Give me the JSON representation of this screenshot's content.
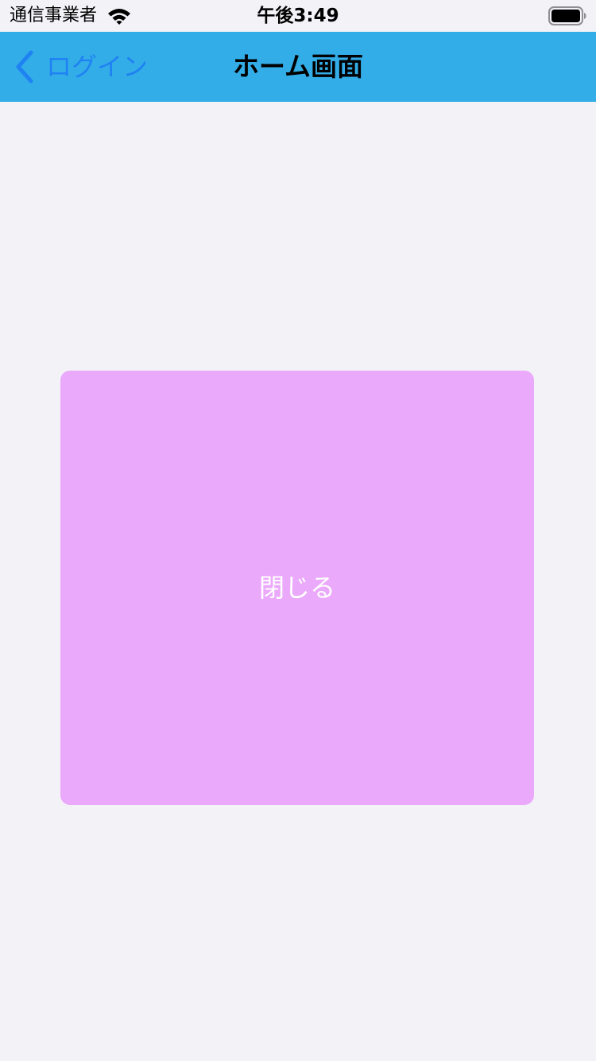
{
  "status_bar": {
    "carrier": "通信事業者",
    "time": "午後3:49",
    "wifi_icon": "wifi-icon",
    "battery_icon": "battery-full-icon"
  },
  "nav_bar": {
    "back_label": "ログイン",
    "back_icon": "chevron-left-icon",
    "title": "ホーム画面",
    "background_color": "#33ade7",
    "back_color": "#1f82f3"
  },
  "main": {
    "close_button_label": "閉じる",
    "close_button_color": "#eba9fb"
  },
  "colors": {
    "page_background": "#f2f2f7"
  }
}
